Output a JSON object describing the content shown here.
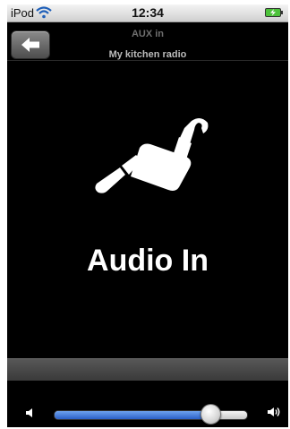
{
  "status_bar": {
    "carrier": "iPod",
    "time": "12:34",
    "wifi_icon": "wifi-icon",
    "battery_icon": "battery-charging-icon",
    "battery_color": "#4cc23a"
  },
  "nav": {
    "back_icon": "back-arrow-icon",
    "title": "AUX in",
    "subtitle": "My kitchen radio"
  },
  "main": {
    "icon": "audio-jack-plug-icon",
    "source_label": "Audio In"
  },
  "volume": {
    "level": 0.81,
    "min_icon": "speaker-low-icon",
    "max_icon": "speaker-high-icon",
    "fill_color": "#3f76d8"
  }
}
